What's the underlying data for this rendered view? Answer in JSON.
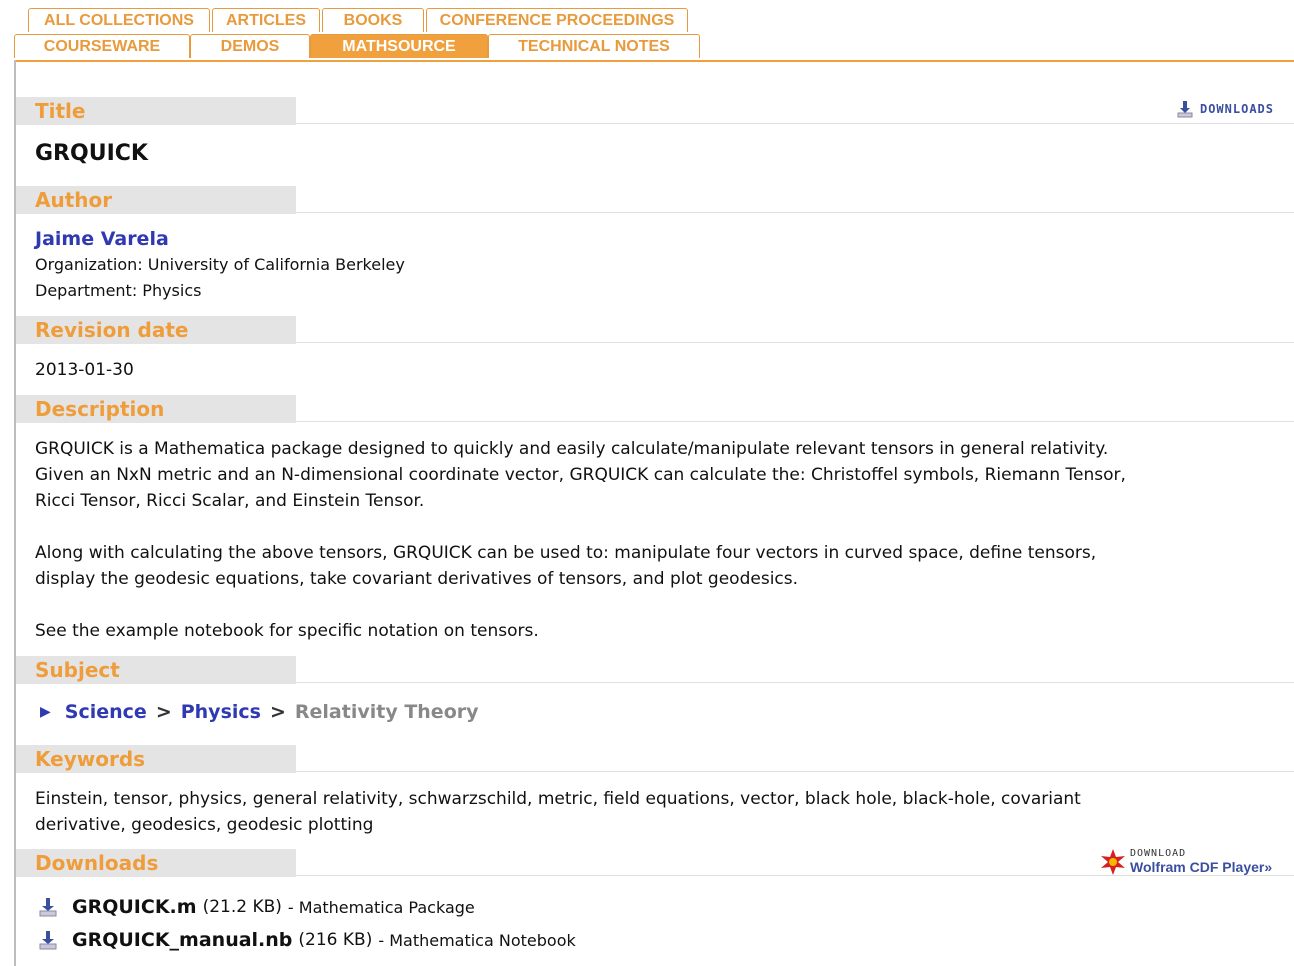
{
  "tabs": {
    "row1": [
      "ALL COLLECTIONS",
      "ARTICLES",
      "BOOKS",
      "CONFERENCE PROCEEDINGS"
    ],
    "row2": [
      "COURSEWARE",
      "DEMOS",
      "MATHSOURCE",
      "TECHNICAL NOTES"
    ],
    "active": "MATHSOURCE"
  },
  "downloads_button": {
    "label": "DOWNLOADS"
  },
  "sections": {
    "title": "Title",
    "author": "Author",
    "revision": "Revision date",
    "description": "Description",
    "subject": "Subject",
    "keywords": "Keywords",
    "downloads": "Downloads"
  },
  "title_value": "GRQUICK",
  "author": {
    "name": "Jaime Varela",
    "organization": "Organization: University of California Berkeley",
    "department": "Department: Physics"
  },
  "revision_date": "2013-01-30",
  "description": {
    "p1_l1": "GRQUICK is a Mathematica package designed to quickly and easily calculate/manipulate relevant tensors in general relativity.",
    "p1_l2": "Given an NxN metric and an N-dimensional coordinate vector, GRQUICK can calculate the: Christoffel symbols, Riemann Tensor,",
    "p1_l3": "Ricci Tensor, Ricci Scalar, and Einstein Tensor.",
    "p2_l1": "Along with calculating the above tensors, GRQUICK can be used to: manipulate four vectors in curved space, define tensors,",
    "p2_l2": "display the geodesic equations, take covariant derivatives of tensors, and plot geodesics.",
    "p3": "See the example notebook for specific notation on tensors."
  },
  "subject": {
    "level1": "Science",
    "sep": ">",
    "level2": "Physics",
    "level3": "Relativity Theory"
  },
  "keywords": {
    "l1": "Einstein, tensor, physics, general relativity, schwarzschild, metric, field equations, vector, black hole, black-hole, covariant",
    "l2": "derivative, geodesics, geodesic plotting"
  },
  "cdf_player": {
    "small": "DOWNLOAD",
    "big": "Wolfram CDF Player»"
  },
  "files": [
    {
      "name": "GRQUICK.m",
      "size": "(21.2 KB)",
      "type": "- Mathematica Package"
    },
    {
      "name": "GRQUICK_manual.nb",
      "size": "(216 KB)",
      "type": "- Mathematica Notebook"
    }
  ],
  "colors": {
    "accent": "#f0a03c",
    "link": "#2f39b2",
    "header_bg": "#e4e4e4"
  }
}
